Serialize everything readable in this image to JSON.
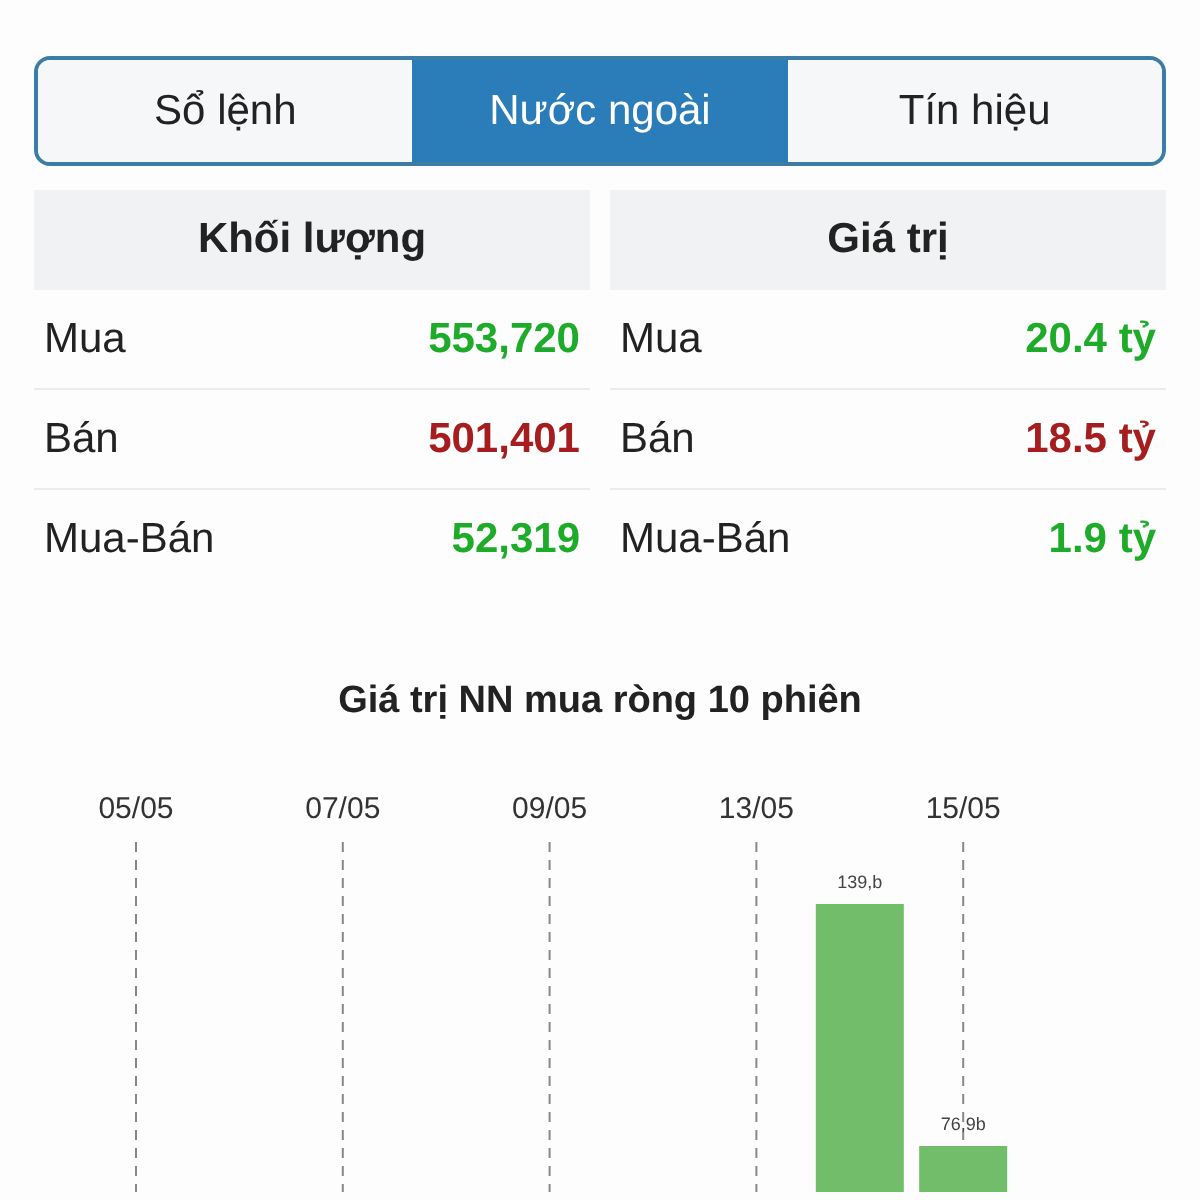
{
  "tabs": [
    {
      "label": "Sổ lệnh",
      "selected": false
    },
    {
      "label": "Nước ngoài",
      "selected": true
    },
    {
      "label": "Tín hiệu",
      "selected": false
    }
  ],
  "panels": [
    {
      "title": "Khối lượng",
      "rows": [
        {
          "label": "Mua",
          "value": "553,720",
          "color": "#1eab2a"
        },
        {
          "label": "Bán",
          "value": "501,401",
          "color": "#a51d1f"
        },
        {
          "label": "Mua-Bán",
          "value": "52,319",
          "color": "#1eab2a"
        }
      ]
    },
    {
      "title": "Giá trị",
      "rows": [
        {
          "label": "Mua",
          "value": "20.4 tỷ",
          "color": "#1eab2a"
        },
        {
          "label": "Bán",
          "value": "18.5 tỷ",
          "color": "#a51d1f"
        },
        {
          "label": "Mua-Bán",
          "value": "1.9 tỷ",
          "color": "#1eab2a"
        }
      ]
    }
  ],
  "chart": {
    "title": "Giá trị NN mua ròng 10 phiên",
    "date_labels": [
      "05/05",
      "07/05",
      "09/05",
      "13/05",
      "15/05"
    ],
    "bar_labels": [
      "139,b",
      "76,9b"
    ]
  }
}
